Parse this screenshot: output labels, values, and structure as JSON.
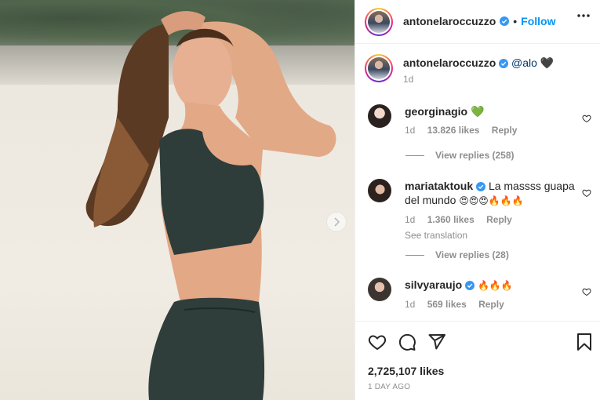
{
  "post": {
    "author": "antonelaroccuzzo",
    "follow_label": "Follow",
    "separator": "•"
  },
  "caption": {
    "username": "antonelaroccuzzo",
    "text": "@alo",
    "emoji": "🖤",
    "time": "1d"
  },
  "comments": [
    {
      "username": "georginagio",
      "text": "",
      "emoji": "💚",
      "time": "1d",
      "likes": "13.826 likes",
      "reply_label": "Reply",
      "verified": false
    },
    {
      "username": "mariataktouk",
      "text": "La massss guapa del mundo",
      "emoji": "😍😍😍🔥🔥🔥",
      "time": "1d",
      "likes": "1.360 likes",
      "reply_label": "Reply",
      "translation_label": "See translation",
      "verified": true
    },
    {
      "username": "silvyaraujo",
      "text": "",
      "emoji": "🔥🔥🔥",
      "time": "1d",
      "likes": "569 likes",
      "reply_label": "Reply",
      "verified": true
    }
  ],
  "view_replies": [
    "View replies (258)",
    "View replies (28)"
  ],
  "footer": {
    "likes": "2,725,107 likes",
    "date": "1 DAY AGO"
  },
  "icons": {
    "verified": "verified-badge-icon",
    "more": "more-options-icon",
    "like": "heart-icon",
    "comment": "comment-icon",
    "share": "paper-plane-icon",
    "save": "bookmark-icon",
    "next": "chevron-right-icon"
  },
  "colors": {
    "accent": "#0095f6",
    "verified": "#3897f0",
    "muted": "#8e8e8e"
  }
}
